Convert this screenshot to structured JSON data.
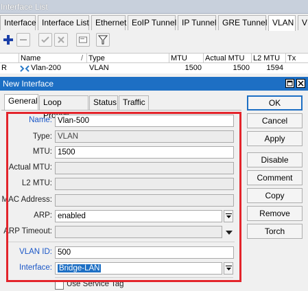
{
  "background_window": {
    "title": "Interface List",
    "tabs": [
      "Interface",
      "Interface List",
      "Ethernet",
      "EoIP Tunnel",
      "IP Tunnel",
      "GRE Tunnel",
      "VLAN",
      "VF"
    ],
    "active_tab": "VLAN",
    "toolbar_icons": [
      "add-icon",
      "remove-icon",
      "enable-icon",
      "disable-icon",
      "comment-icon",
      "filter-icon"
    ],
    "columns": [
      "",
      "Name",
      "/",
      "Type",
      "MTU",
      "Actual MTU",
      "L2 MTU",
      "Tx"
    ],
    "rows": [
      {
        "flag": "R",
        "name": "Vlan-200",
        "type": "VLAN",
        "mtu": "1500",
        "actual_mtu": "1500",
        "l2_mtu": "1594",
        "tx": ""
      }
    ]
  },
  "dialog": {
    "title": "New Interface",
    "tabs": [
      "General",
      "Loop Protect",
      "Status",
      "Traffic"
    ],
    "active_tab": "General",
    "fields": {
      "name": {
        "label": "Name:",
        "value": "Vlan-500"
      },
      "type": {
        "label": "Type:",
        "value": "VLAN"
      },
      "mtu": {
        "label": "MTU:",
        "value": "1500"
      },
      "actual_mtu": {
        "label": "Actual MTU:",
        "value": ""
      },
      "l2_mtu": {
        "label": "L2 MTU:",
        "value": ""
      },
      "mac_address": {
        "label": "MAC Address:",
        "value": ""
      },
      "arp": {
        "label": "ARP:",
        "value": "enabled"
      },
      "arp_timeout": {
        "label": "ARP Timeout:",
        "value": ""
      },
      "vlan_id": {
        "label": "VLAN ID:",
        "value": "500"
      },
      "interface": {
        "label": "Interface:",
        "value": "Bridge-LAN"
      },
      "use_service_tag": {
        "label": "Use Service Tag",
        "checked": false
      }
    },
    "buttons": [
      "OK",
      "Cancel",
      "Apply",
      "Disable",
      "Comment",
      "Copy",
      "Remove",
      "Torch"
    ]
  },
  "colors": {
    "title_bar": "#1d6fc4",
    "highlight_box": "#e3242b",
    "label_blue": "#1a56c7"
  }
}
